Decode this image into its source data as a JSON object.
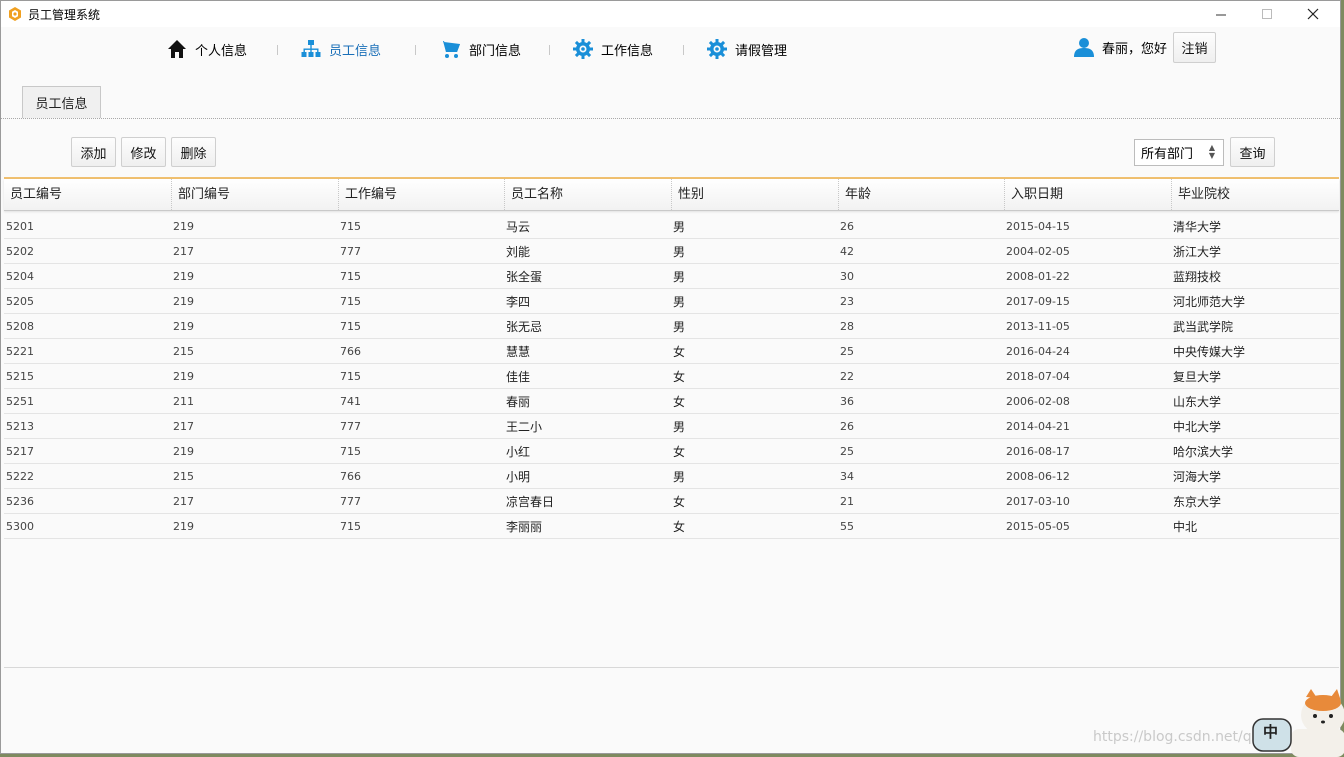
{
  "window": {
    "title": "员工管理系统"
  },
  "nav": [
    {
      "label": "个人信息",
      "icon": "home-icon",
      "active": false
    },
    {
      "label": "员工信息",
      "icon": "org-chart-icon",
      "active": true
    },
    {
      "label": "部门信息",
      "icon": "cart-icon",
      "active": false
    },
    {
      "label": "工作信息",
      "icon": "gear-icon",
      "active": false
    },
    {
      "label": "请假管理",
      "icon": "gear-icon",
      "active": false
    }
  ],
  "user": {
    "greeting": "春丽，您好",
    "logout_label": "注销",
    "icon": "user-icon"
  },
  "tab": {
    "label": "员工信息"
  },
  "toolbar": {
    "add_label": "添加",
    "edit_label": "修改",
    "delete_label": "删除",
    "department_select": "所有部门",
    "query_label": "查询"
  },
  "table": {
    "columns": [
      "员工编号",
      "部门编号",
      "工作编号",
      "员工名称",
      "性别",
      "年龄",
      "入职日期",
      "毕业院校"
    ],
    "rows": [
      [
        "5201",
        "219",
        "715",
        "马云",
        "男",
        "26",
        "2015-04-15",
        "清华大学"
      ],
      [
        "5202",
        "217",
        "777",
        "刘能",
        "男",
        "42",
        "2004-02-05",
        "浙江大学"
      ],
      [
        "5204",
        "219",
        "715",
        "张全蛋",
        "男",
        "30",
        "2008-01-22",
        "蓝翔技校"
      ],
      [
        "5205",
        "219",
        "715",
        "李四",
        "男",
        "23",
        "2017-09-15",
        "河北师范大学"
      ],
      [
        "5208",
        "219",
        "715",
        "张无忌",
        "男",
        "28",
        "2013-11-05",
        "武当武学院"
      ],
      [
        "5221",
        "215",
        "766",
        "慧慧",
        "女",
        "25",
        "2016-04-24",
        "中央传媒大学"
      ],
      [
        "5215",
        "219",
        "715",
        "佳佳",
        "女",
        "22",
        "2018-07-04",
        "复旦大学"
      ],
      [
        "5251",
        "211",
        "741",
        "春丽",
        "女",
        "36",
        "2006-02-08",
        "山东大学"
      ],
      [
        "5213",
        "217",
        "777",
        "王二小",
        "男",
        "26",
        "2014-04-21",
        "中北大学"
      ],
      [
        "5217",
        "219",
        "715",
        "小红",
        "女",
        "25",
        "2016-08-17",
        "哈尔滨大学"
      ],
      [
        "5222",
        "215",
        "766",
        "小明",
        "男",
        "34",
        "2008-06-12",
        "河海大学"
      ],
      [
        "5236",
        "217",
        "777",
        "凉宫春日",
        "女",
        "21",
        "2017-03-10",
        "东京大学"
      ],
      [
        "5300",
        "219",
        "715",
        "李丽丽",
        "女",
        "55",
        "2015-05-05",
        "中北"
      ]
    ]
  },
  "ime_indicator": "中",
  "watermark": "https://blog.csdn.net/q",
  "colors": {
    "accent": "#1a8fd8",
    "table_top_border": "#f0c070",
    "icon_orange": "#f0a020"
  }
}
